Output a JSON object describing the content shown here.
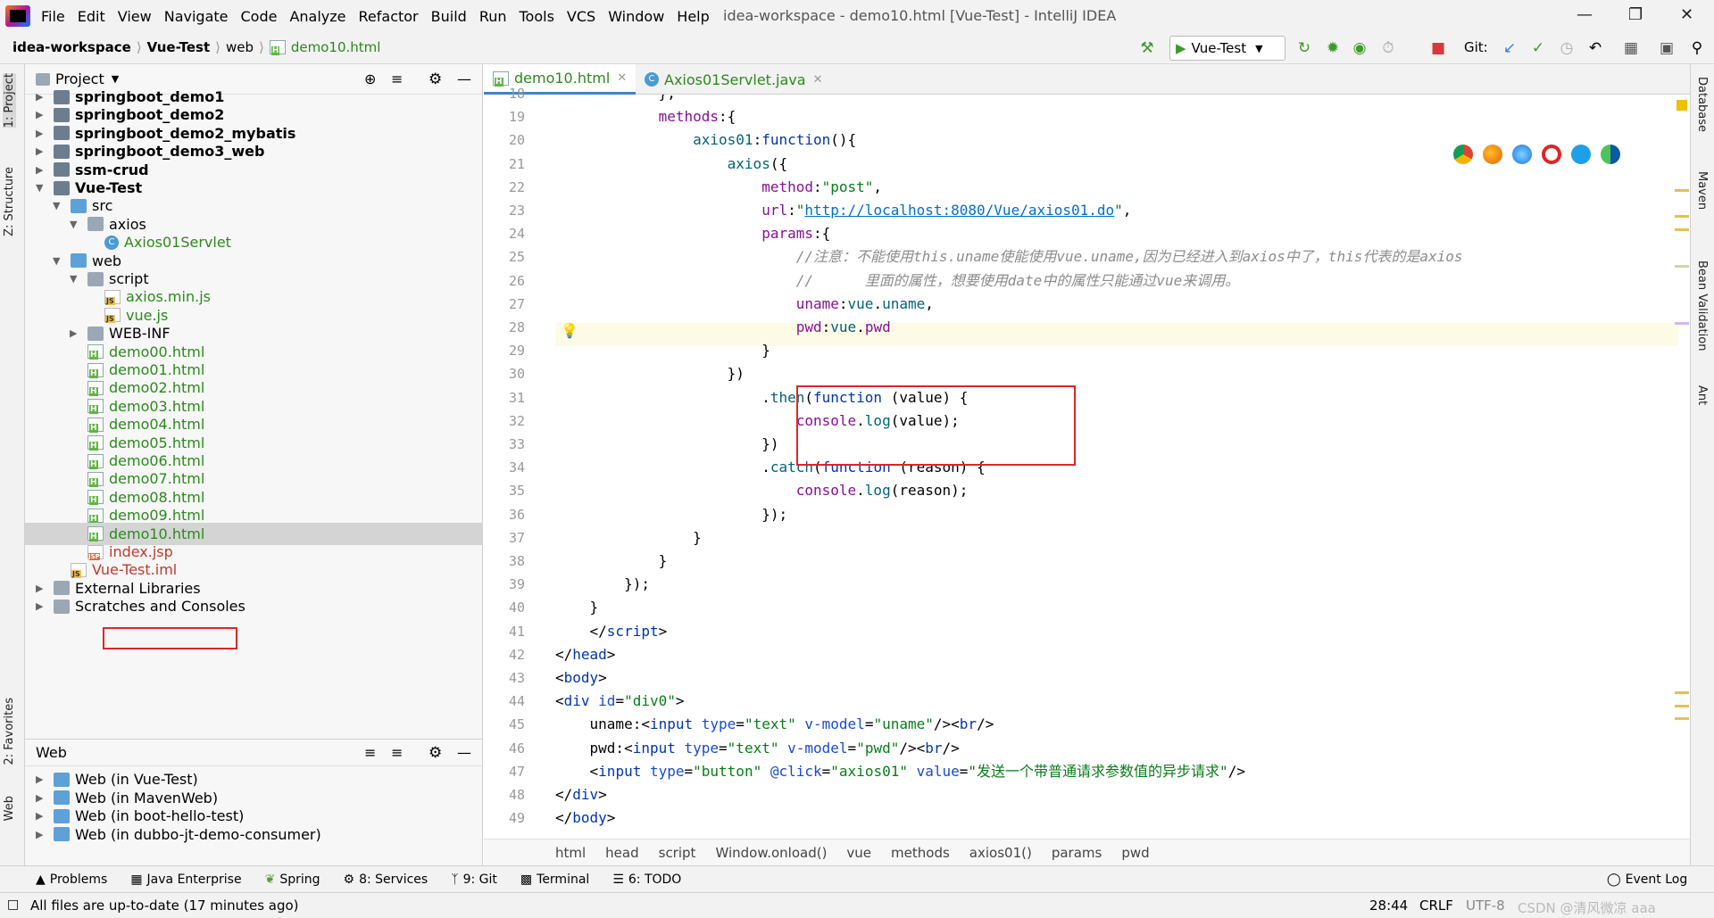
{
  "menubar": {
    "items": [
      "File",
      "Edit",
      "View",
      "Navigate",
      "Code",
      "Analyze",
      "Refactor",
      "Build",
      "Run",
      "Tools",
      "VCS",
      "Window",
      "Help"
    ],
    "window_title": "idea-workspace - demo10.html [Vue-Test] - IntelliJ IDEA"
  },
  "navbar": {
    "breadcrumbs": [
      "idea-workspace",
      "Vue-Test",
      "web",
      "demo10.html"
    ],
    "run_config": "Vue-Test",
    "git_label": "Git:"
  },
  "left_strip": {
    "tabs": [
      "1: Project",
      "Z: Structure",
      "2: Favorites",
      "Web"
    ]
  },
  "right_strip": {
    "tabs": [
      "Database",
      "Maven",
      "Bean Validation",
      "Ant"
    ]
  },
  "project_panel": {
    "title": "Project",
    "tree": [
      {
        "label": "springboot_demo1",
        "bold": true,
        "icon": "module-folder",
        "indent": 0,
        "arrow": "right"
      },
      {
        "label": "springboot_demo2",
        "bold": true,
        "icon": "module-folder",
        "indent": 0,
        "arrow": "right"
      },
      {
        "label": "springboot_demo2_mybatis",
        "bold": true,
        "icon": "module-folder",
        "indent": 0,
        "arrow": "right"
      },
      {
        "label": "springboot_demo3_web",
        "bold": true,
        "icon": "module-folder",
        "indent": 0,
        "arrow": "right"
      },
      {
        "label": "ssm-crud",
        "bold": true,
        "icon": "module-folder",
        "indent": 0,
        "arrow": "right"
      },
      {
        "label": "Vue-Test",
        "bold": true,
        "icon": "module-folder",
        "indent": 0,
        "arrow": "down"
      },
      {
        "label": "src",
        "bold": false,
        "icon": "source-folder",
        "indent": 1,
        "arrow": "down"
      },
      {
        "label": "axios",
        "bold": false,
        "icon": "folder",
        "indent": 2,
        "arrow": "down"
      },
      {
        "label": "Axios01Servlet",
        "bold": false,
        "icon": "class",
        "indent": 3,
        "arrow": "",
        "color": "green"
      },
      {
        "label": "web",
        "bold": false,
        "icon": "web-folder",
        "indent": 1,
        "arrow": "down"
      },
      {
        "label": "script",
        "bold": false,
        "icon": "folder",
        "indent": 2,
        "arrow": "down"
      },
      {
        "label": "axios.min.js",
        "bold": false,
        "icon": "js",
        "indent": 3,
        "arrow": "",
        "color": "green"
      },
      {
        "label": "vue.js",
        "bold": false,
        "icon": "js",
        "indent": 3,
        "arrow": "",
        "color": "green"
      },
      {
        "label": "WEB-INF",
        "bold": false,
        "icon": "folder",
        "indent": 2,
        "arrow": "right"
      },
      {
        "label": "demo00.html",
        "bold": false,
        "icon": "html",
        "indent": 2,
        "arrow": "",
        "color": "green"
      },
      {
        "label": "demo01.html",
        "bold": false,
        "icon": "html",
        "indent": 2,
        "arrow": "",
        "color": "green"
      },
      {
        "label": "demo02.html",
        "bold": false,
        "icon": "html",
        "indent": 2,
        "arrow": "",
        "color": "green"
      },
      {
        "label": "demo03.html",
        "bold": false,
        "icon": "html",
        "indent": 2,
        "arrow": "",
        "color": "green"
      },
      {
        "label": "demo04.html",
        "bold": false,
        "icon": "html",
        "indent": 2,
        "arrow": "",
        "color": "green"
      },
      {
        "label": "demo05.html",
        "bold": false,
        "icon": "html",
        "indent": 2,
        "arrow": "",
        "color": "green"
      },
      {
        "label": "demo06.html",
        "bold": false,
        "icon": "html",
        "indent": 2,
        "arrow": "",
        "color": "green"
      },
      {
        "label": "demo07.html",
        "bold": false,
        "icon": "html",
        "indent": 2,
        "arrow": "",
        "color": "green"
      },
      {
        "label": "demo08.html",
        "bold": false,
        "icon": "html",
        "indent": 2,
        "arrow": "",
        "color": "green"
      },
      {
        "label": "demo09.html",
        "bold": false,
        "icon": "html",
        "indent": 2,
        "arrow": "",
        "color": "green"
      },
      {
        "label": "demo10.html",
        "bold": false,
        "icon": "html",
        "indent": 2,
        "arrow": "",
        "color": "green",
        "selected": true
      },
      {
        "label": "index.jsp",
        "bold": false,
        "icon": "jsp",
        "indent": 2,
        "arrow": "",
        "color": "red"
      },
      {
        "label": "Vue-Test.iml",
        "bold": false,
        "icon": "iml",
        "indent": 1,
        "arrow": "",
        "color": "red"
      },
      {
        "label": "External Libraries",
        "bold": false,
        "icon": "libs",
        "indent": 0,
        "arrow": "right"
      },
      {
        "label": "Scratches and Consoles",
        "bold": false,
        "icon": "scratch",
        "indent": 0,
        "arrow": "right"
      }
    ]
  },
  "web_panel": {
    "title": "Web",
    "items": [
      "Web (in Vue-Test)",
      "Web (in MavenWeb)",
      "Web (in boot-hello-test)",
      "Web (in dubbo-jt-demo-consumer)"
    ]
  },
  "editor_tabs": [
    {
      "label": "demo10.html",
      "active": true,
      "icon": "html"
    },
    {
      "label": "Axios01Servlet.java",
      "active": false,
      "icon": "class"
    }
  ],
  "editor": {
    "lines": [
      {
        "n": "18",
        "segs": [
          [
            "p",
            "            },"
          ]
        ]
      },
      {
        "n": "19",
        "segs": [
          [
            "p",
            "            "
          ],
          [
            "v",
            "methods"
          ],
          [
            "p",
            ":{"
          ]
        ]
      },
      {
        "n": "20",
        "segs": [
          [
            "p",
            "                "
          ],
          [
            "f",
            "axios01"
          ],
          [
            "p",
            ":"
          ],
          [
            "k",
            "function"
          ],
          [
            "p",
            "(){"
          ]
        ]
      },
      {
        "n": "21",
        "segs": [
          [
            "p",
            "                    "
          ],
          [
            "f",
            "axios"
          ],
          [
            "p",
            "({"
          ]
        ]
      },
      {
        "n": "22",
        "segs": [
          [
            "p",
            "                        "
          ],
          [
            "v",
            "method"
          ],
          [
            "p",
            ":"
          ],
          [
            "s",
            "\"post\""
          ],
          [
            "p",
            ","
          ]
        ]
      },
      {
        "n": "23",
        "segs": [
          [
            "p",
            "                        "
          ],
          [
            "v",
            "url"
          ],
          [
            "p",
            ":"
          ],
          [
            "s",
            "\""
          ],
          [
            "u",
            "http://localhost:8080/Vue/axios01.do"
          ],
          [
            "s",
            "\""
          ],
          [
            "p",
            ","
          ]
        ]
      },
      {
        "n": "24",
        "segs": [
          [
            "p",
            "                        "
          ],
          [
            "v",
            "params"
          ],
          [
            "p",
            ":{"
          ]
        ]
      },
      {
        "n": "25",
        "segs": [
          [
            "p",
            "                            "
          ],
          [
            "c",
            "//注意：不能使用this.uname使能使用vue.uname,因为已经进入到axios中了，this代表的是axios"
          ]
        ]
      },
      {
        "n": "26",
        "segs": [
          [
            "p",
            "                            "
          ],
          [
            "c",
            "//      里面的属性，想要使用date中的属性只能通过vue来调用。"
          ]
        ]
      },
      {
        "n": "27",
        "segs": [
          [
            "p",
            "                            "
          ],
          [
            "v",
            "uname"
          ],
          [
            "p",
            ":"
          ],
          [
            "f",
            "vue"
          ],
          [
            "p",
            "."
          ],
          [
            "f",
            "uname"
          ],
          [
            "p",
            ","
          ]
        ]
      },
      {
        "n": "28",
        "segs": [
          [
            "p",
            "                            "
          ],
          [
            "v",
            "pwd"
          ],
          [
            "p",
            ":"
          ],
          [
            "f",
            "vue"
          ],
          [
            "p",
            "."
          ],
          [
            "v",
            "pwd"
          ]
        ]
      },
      {
        "n": "29",
        "segs": [
          [
            "p",
            "                        }"
          ]
        ]
      },
      {
        "n": "30",
        "segs": [
          [
            "p",
            "                    })"
          ]
        ]
      },
      {
        "n": "31",
        "segs": [
          [
            "p",
            "                        ."
          ],
          [
            "f",
            "then"
          ],
          [
            "p",
            "("
          ],
          [
            "k",
            "function"
          ],
          [
            "p",
            " ("
          ],
          [
            "p",
            "value"
          ],
          [
            "p",
            ") {"
          ]
        ]
      },
      {
        "n": "32",
        "segs": [
          [
            "p",
            "                            "
          ],
          [
            "v",
            "console"
          ],
          [
            "p",
            "."
          ],
          [
            "f",
            "log"
          ],
          [
            "p",
            "(value);"
          ]
        ]
      },
      {
        "n": "33",
        "segs": [
          [
            "p",
            "                        })"
          ]
        ]
      },
      {
        "n": "34",
        "segs": [
          [
            "p",
            "                        ."
          ],
          [
            "f",
            "catch"
          ],
          [
            "p",
            "("
          ],
          [
            "k",
            "function"
          ],
          [
            "p",
            " (reason) {"
          ]
        ]
      },
      {
        "n": "35",
        "segs": [
          [
            "p",
            "                            "
          ],
          [
            "v",
            "console"
          ],
          [
            "p",
            "."
          ],
          [
            "f",
            "log"
          ],
          [
            "p",
            "(reason);"
          ]
        ]
      },
      {
        "n": "36",
        "segs": [
          [
            "p",
            "                        });"
          ]
        ]
      },
      {
        "n": "37",
        "segs": [
          [
            "p",
            "                }"
          ]
        ]
      },
      {
        "n": "38",
        "segs": [
          [
            "p",
            "            }"
          ]
        ]
      },
      {
        "n": "39",
        "segs": [
          [
            "p",
            "        });"
          ]
        ]
      },
      {
        "n": "40",
        "segs": [
          [
            "p",
            "    }"
          ]
        ]
      },
      {
        "n": "41",
        "segs": [
          [
            "p",
            "    </"
          ],
          [
            "t",
            "script"
          ],
          [
            "p",
            ">"
          ]
        ]
      },
      {
        "n": "42",
        "segs": [
          [
            "p",
            "</"
          ],
          [
            "t",
            "head"
          ],
          [
            "p",
            ">"
          ]
        ]
      },
      {
        "n": "43",
        "segs": [
          [
            "p",
            "<"
          ],
          [
            "t",
            "body"
          ],
          [
            "p",
            ">"
          ]
        ]
      },
      {
        "n": "44",
        "segs": [
          [
            "p",
            "<"
          ],
          [
            "t",
            "div "
          ],
          [
            "a",
            "id"
          ],
          [
            "p",
            "="
          ],
          [
            "av",
            "\"div0\""
          ],
          [
            "p",
            ">"
          ]
        ]
      },
      {
        "n": "45",
        "segs": [
          [
            "p",
            "    uname:<"
          ],
          [
            "t",
            "input "
          ],
          [
            "a",
            "type"
          ],
          [
            "p",
            "="
          ],
          [
            "av",
            "\"text\" "
          ],
          [
            "a",
            "v-model"
          ],
          [
            "p",
            "="
          ],
          [
            "av",
            "\"uname\""
          ],
          [
            "p",
            "/><"
          ],
          [
            "t",
            "br"
          ],
          [
            "p",
            "/>"
          ]
        ]
      },
      {
        "n": "46",
        "segs": [
          [
            "p",
            "    pwd:<"
          ],
          [
            "t",
            "input "
          ],
          [
            "a",
            "type"
          ],
          [
            "p",
            "="
          ],
          [
            "av",
            "\"text\" "
          ],
          [
            "a",
            "v-model"
          ],
          [
            "p",
            "="
          ],
          [
            "av",
            "\"pwd\""
          ],
          [
            "p",
            "/><"
          ],
          [
            "t",
            "br"
          ],
          [
            "p",
            "/>"
          ]
        ]
      },
      {
        "n": "47",
        "segs": [
          [
            "p",
            "    <"
          ],
          [
            "t",
            "input "
          ],
          [
            "a",
            "type"
          ],
          [
            "p",
            "="
          ],
          [
            "av",
            "\"button\" "
          ],
          [
            "a",
            "@click"
          ],
          [
            "p",
            "="
          ],
          [
            "av",
            "\"axios01\" "
          ],
          [
            "a",
            "value"
          ],
          [
            "p",
            "="
          ],
          [
            "av",
            "\"发送一个带普通请求参数值的异步请求\""
          ],
          [
            "p",
            "/>"
          ]
        ]
      },
      {
        "n": "48",
        "segs": [
          [
            "p",
            "</"
          ],
          [
            "t",
            "div"
          ],
          [
            "p",
            ">"
          ]
        ]
      },
      {
        "n": "49",
        "segs": [
          [
            "p",
            "</"
          ],
          [
            "t",
            "body"
          ],
          [
            "p",
            ">"
          ]
        ]
      }
    ]
  },
  "editor_breadcrumb": [
    "html",
    "head",
    "script",
    "Window.onload()",
    "vue",
    "methods",
    "axios01()",
    "params",
    "pwd"
  ],
  "bottom_tools": [
    "Problems",
    "Java Enterprise",
    "Spring",
    "8: Services",
    "9: Git",
    "Terminal",
    "6: TODO",
    "Event Log"
  ],
  "status": {
    "message": "All files are up-to-date (17 minutes ago)",
    "position": "28:44",
    "line_sep": "CRLF",
    "encoding": "UTF-8",
    "watermark": "CSDN @清风微凉 aaa"
  }
}
